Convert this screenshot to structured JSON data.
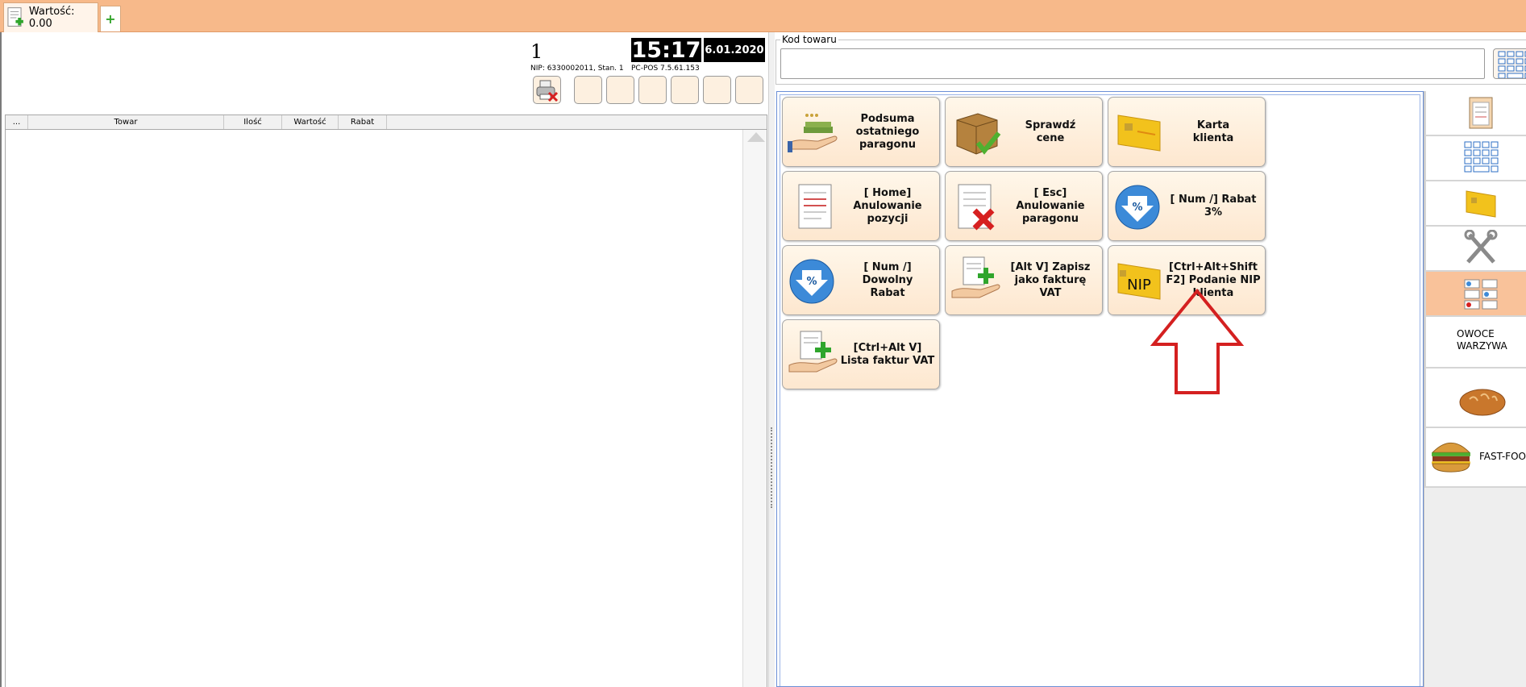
{
  "tab": {
    "title": "Wartość: 0.00",
    "add_label": "+"
  },
  "header": {
    "receipt_number": "1",
    "nip_info": "NIP: 6330002011, Stan. 1",
    "time": "15:17",
    "date": "6.01.2020",
    "version": "PC-POS 7.5.61.153"
  },
  "grid": {
    "columns": [
      "...",
      "Towar",
      "Ilość",
      "Wartość",
      "Rabat"
    ]
  },
  "search": {
    "label": "Kod towaru",
    "value": ""
  },
  "functions": [
    {
      "label": "Podsuma\nostatniego\nparagonu",
      "icon": "receipt-hand-icon"
    },
    {
      "label": "Sprawdź\ncene",
      "icon": "box-check-icon"
    },
    {
      "label": "Karta\nklienta",
      "icon": "client-card-icon"
    },
    {
      "label": "[ Home]\nAnulowanie\npozycji",
      "icon": "document-lines-icon"
    },
    {
      "label": "[ Esc]\nAnulowanie\nparagonu",
      "icon": "document-cancel-icon"
    },
    {
      "label": "[ Num /] Rabat\n3%",
      "icon": "percent-discount-icon"
    },
    {
      "label": "[ Num /] Dowolny\nRabat",
      "icon": "percent-discount-icon"
    },
    {
      "label": "[Alt V] Zapisz\njako fakturę VAT",
      "icon": "invoice-add-icon"
    },
    {
      "label": "[Ctrl+Alt+Shift\nF2] Podanie NIP\nklienta",
      "icon": "nip-card-icon",
      "icon_text": "NIP"
    },
    {
      "label": "[Ctrl+Alt V]\nLista faktur VAT",
      "icon": "invoice-list-icon"
    }
  ],
  "categories": [
    {
      "name": "",
      "icon": "clipboard-icon"
    },
    {
      "name": "",
      "icon": "keypad-icon"
    },
    {
      "name": "",
      "icon": "client-card-icon"
    },
    {
      "name": "",
      "icon": "tools-icon"
    },
    {
      "name": "",
      "icon": "function-buttons-icon"
    },
    {
      "name": "OWOCE\nWARZYWA",
      "icon": ""
    },
    {
      "name": "",
      "icon": "bread-icon"
    },
    {
      "name": "FAST-FOO",
      "icon": "burger-icon"
    }
  ],
  "colors": {
    "topbar": "#f7b98a",
    "active_category": "#f9c29a",
    "annotation_arrow": "#d42020"
  }
}
